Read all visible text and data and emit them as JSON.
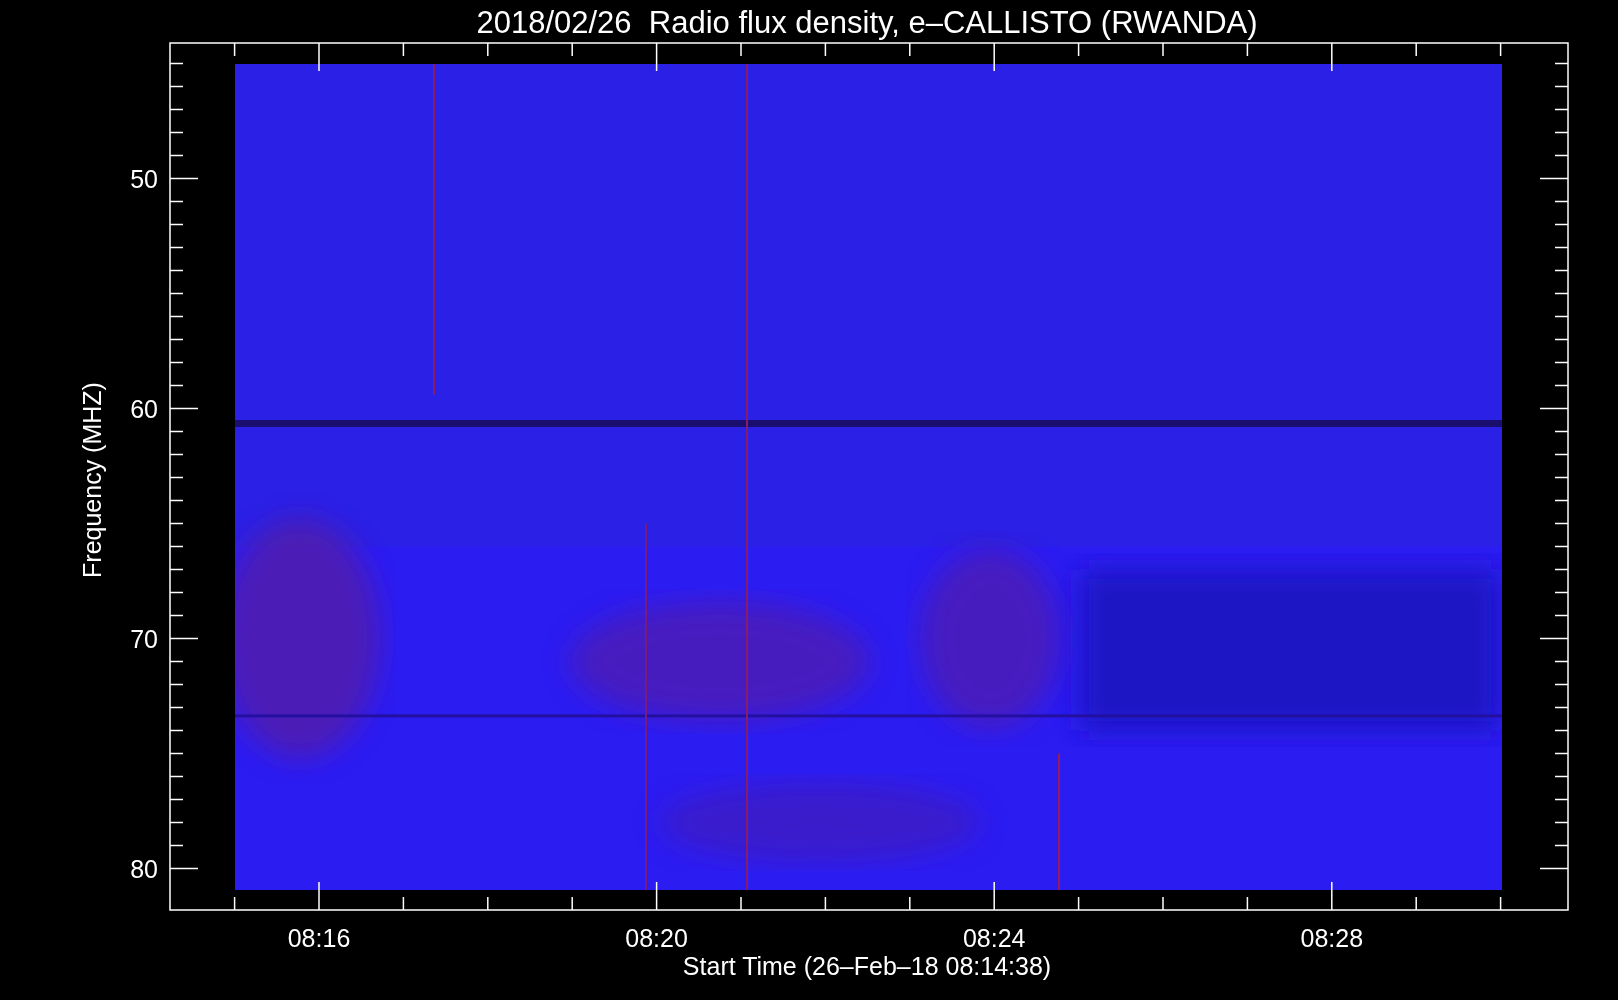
{
  "title": "2018/02/26  Radio flux density, e–CALLISTO (RWANDA)",
  "y_axis": {
    "label": "Frequency (MHZ)",
    "ticks": [
      "50",
      "60",
      "70",
      "80"
    ]
  },
  "x_axis": {
    "label": "Start Time (26–Feb–18 08:14:38)",
    "ticks": [
      "08:16",
      "08:20",
      "08:24",
      "08:28"
    ]
  }
}
